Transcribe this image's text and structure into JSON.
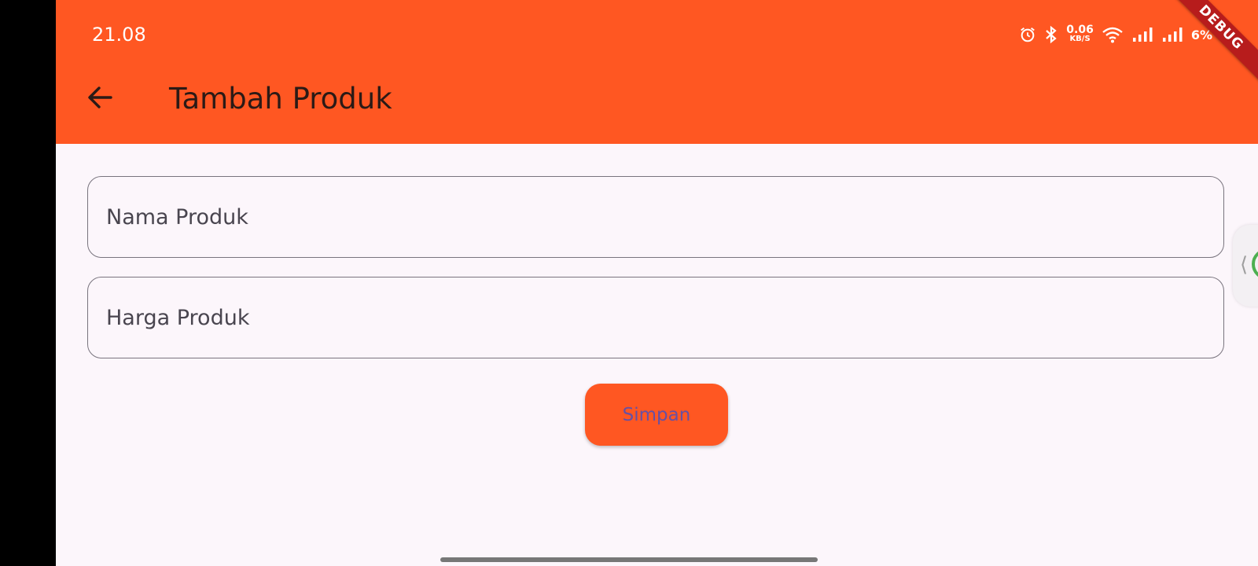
{
  "status_bar": {
    "time": "21.08",
    "net_speed_value": "0.06",
    "net_speed_unit": "KB/S",
    "battery": "6%",
    "icons": [
      "alarm-icon",
      "bluetooth-icon",
      "wifi-icon",
      "signal-icon",
      "signal-icon"
    ]
  },
  "app_bar": {
    "title": "Tambah Produk",
    "back_icon": "arrow-back-icon",
    "background_color": "#ff5722"
  },
  "debug_banner": "DEBUG",
  "form": {
    "fields": [
      {
        "label": "Nama Produk",
        "value": ""
      },
      {
        "label": "Harga Produk",
        "value": ""
      }
    ],
    "submit_label": "Simpan",
    "submit_color": "#ff5722",
    "submit_text_color": "#6750a4"
  },
  "side_handle": {
    "chevron": "⟨"
  }
}
